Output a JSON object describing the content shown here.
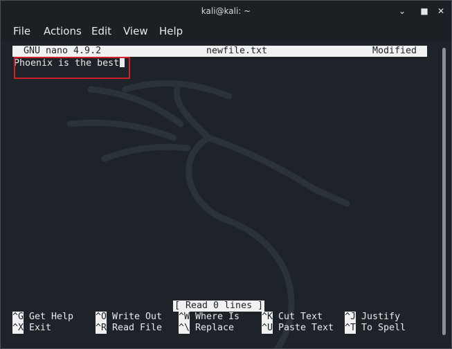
{
  "window": {
    "title": "kali@kali: ~"
  },
  "menu": {
    "items": [
      "File",
      "Actions",
      "Edit",
      "View",
      "Help"
    ]
  },
  "nano": {
    "version": "GNU nano 4.9.2",
    "filename": "newfile.txt",
    "state": "Modified",
    "content": "Phoenix is the best",
    "status": "[ Read 0 lines ]"
  },
  "shortcuts": [
    {
      "key": "^G",
      "label": "Get Help"
    },
    {
      "key": "^O",
      "label": "Write Out"
    },
    {
      "key": "^W",
      "label": "Where Is"
    },
    {
      "key": "^K",
      "label": "Cut Text"
    },
    {
      "key": "^J",
      "label": "Justify"
    },
    {
      "key": "^X",
      "label": "Exit"
    },
    {
      "key": "^R",
      "label": "Read File"
    },
    {
      "key": "^\\",
      "label": "Replace"
    },
    {
      "key": "^U",
      "label": "Paste Text"
    },
    {
      "key": "^T",
      "label": "To Spell"
    }
  ],
  "colors": {
    "terminal_bg": "#1d2329",
    "highlight": "#d0202a",
    "bar_bg": "#f1f1f1"
  }
}
